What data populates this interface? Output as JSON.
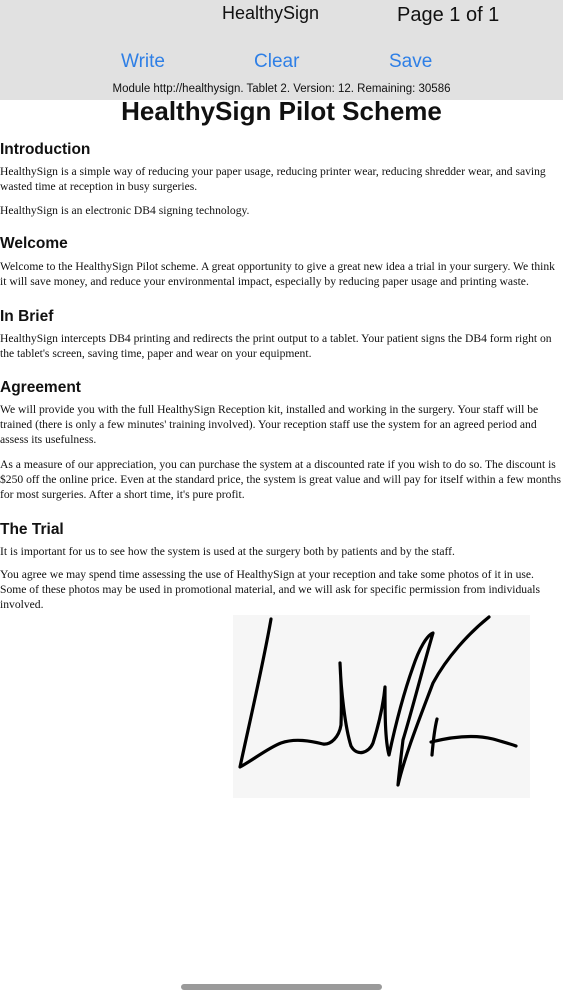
{
  "header": {
    "app_title": "HealthySign",
    "page_indicator": "Page 1 of 1",
    "write_label": "Write",
    "clear_label": "Clear",
    "save_label": "Save",
    "module_info": "Module http://healthysign. Tablet 2. Version: 12. Remaining: 30586"
  },
  "document": {
    "title": "HealthySign Pilot Scheme",
    "sections": [
      {
        "heading": "Introduction",
        "paragraphs": [
          "HealthySign is a simple way of reducing your paper usage, reducing printer wear, reducing shredder wear, and saving wasted time at reception in busy surgeries.",
          "HealthySign is an electronic DB4 signing technology."
        ]
      },
      {
        "heading": "Welcome",
        "paragraphs": [
          "Welcome to the HealthySign Pilot scheme. A great opportunity to give a great new idea a trial in your surgery. We think it will save money, and reduce your environmental impact, especially by reducing paper usage and printing waste."
        ]
      },
      {
        "heading": "In Brief",
        "paragraphs": [
          "HealthySign intercepts DB4 printing and redirects the print output to a tablet. Your patient signs the DB4 form right on the tablet's screen, saving time, paper and wear on your equipment."
        ]
      },
      {
        "heading": "Agreement",
        "paragraphs": [
          "We will provide you with the full HealthySign Reception kit, installed and working in the surgery. Your staff will be trained (there is only a few minutes' training involved). Your reception staff use the system for an agreed period and assess its usefulness.",
          "As a measure of our appreciation, you can purchase the system at a discounted rate if you wish to do so. The discount is $250 off the online price. Even at the standard price, the system is great value and will pay for itself within a few months for most surgeries. After a short time, it's pure profit."
        ]
      },
      {
        "heading": "The Trial",
        "paragraphs": [
          "It is important for us to see how the system is used at the surgery both by patients and by the staff.",
          "You agree we may spend time assessing the use of HealthySign at your reception and take some photos of it in use. Some of these photos may be used in promotional material, and we will ask for specific permission from individuals involved."
        ]
      }
    ]
  },
  "signature": {
    "stroke_color": "#000000",
    "pad_color": "#f6f6f6"
  },
  "colors": {
    "toolbar_bg": "#e1e1e1",
    "button_text": "#2e7fe6"
  }
}
